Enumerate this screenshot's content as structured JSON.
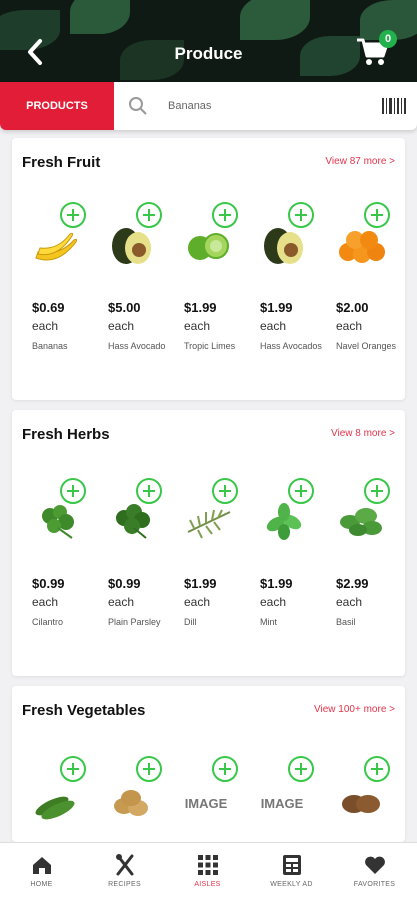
{
  "header": {
    "title": "Produce",
    "cart_count": "0"
  },
  "search": {
    "tab_label": "PRODUCTS",
    "value": "Bananas"
  },
  "sections": [
    {
      "title": "Fresh Fruit",
      "view_more": "View 87 more >",
      "products": [
        {
          "price": "$0.69",
          "unit": "each",
          "name": "Bananas",
          "icon": "banana"
        },
        {
          "price": "$5.00",
          "unit": "each",
          "name": "Hass Avocado",
          "icon": "avocado"
        },
        {
          "price": "$1.99",
          "unit": "each",
          "name": "Tropic Limes",
          "icon": "lime"
        },
        {
          "price": "$1.99",
          "unit": "each",
          "name": "Hass Avocados",
          "icon": "avocado"
        },
        {
          "price": "$2.00",
          "unit": "each",
          "name": "Navel Oranges",
          "icon": "orange"
        }
      ]
    },
    {
      "title": "Fresh Herbs",
      "view_more": "View 8 more >",
      "products": [
        {
          "price": "$0.99",
          "unit": "each",
          "name": "Cilantro",
          "icon": "herb"
        },
        {
          "price": "$0.99",
          "unit": "each",
          "name": "Plain Parsley",
          "icon": "herb"
        },
        {
          "price": "$1.99",
          "unit": "each",
          "name": "Dill",
          "icon": "herb"
        },
        {
          "price": "$1.99",
          "unit": "each",
          "name": "Mint",
          "icon": "herb"
        },
        {
          "price": "$2.99",
          "unit": "each",
          "name": "Basil",
          "icon": "herb"
        }
      ]
    },
    {
      "title": "Fresh Vegetables",
      "view_more": "View 100+ more >",
      "products": [
        {
          "icon": "cucumber"
        },
        {
          "icon": "potato"
        },
        {
          "icon": "image-placeholder",
          "placeholder_text": "IMAGE"
        },
        {
          "icon": "image-placeholder",
          "placeholder_text": "IMAGE"
        },
        {
          "icon": "potato"
        }
      ]
    }
  ],
  "nav": [
    {
      "label": "HOME",
      "icon": "home-icon"
    },
    {
      "label": "RECIPES",
      "icon": "utensils-icon"
    },
    {
      "label": "AISLES",
      "icon": "grid-icon",
      "active": true
    },
    {
      "label": "WEEKLY AD",
      "icon": "ad-icon"
    },
    {
      "label": "FAVORITES",
      "icon": "heart-icon"
    }
  ],
  "colors": {
    "accent_red": "#e21d37",
    "add_green": "#39c74a",
    "badge_green": "#22b14c",
    "link_red": "#e3354b"
  }
}
